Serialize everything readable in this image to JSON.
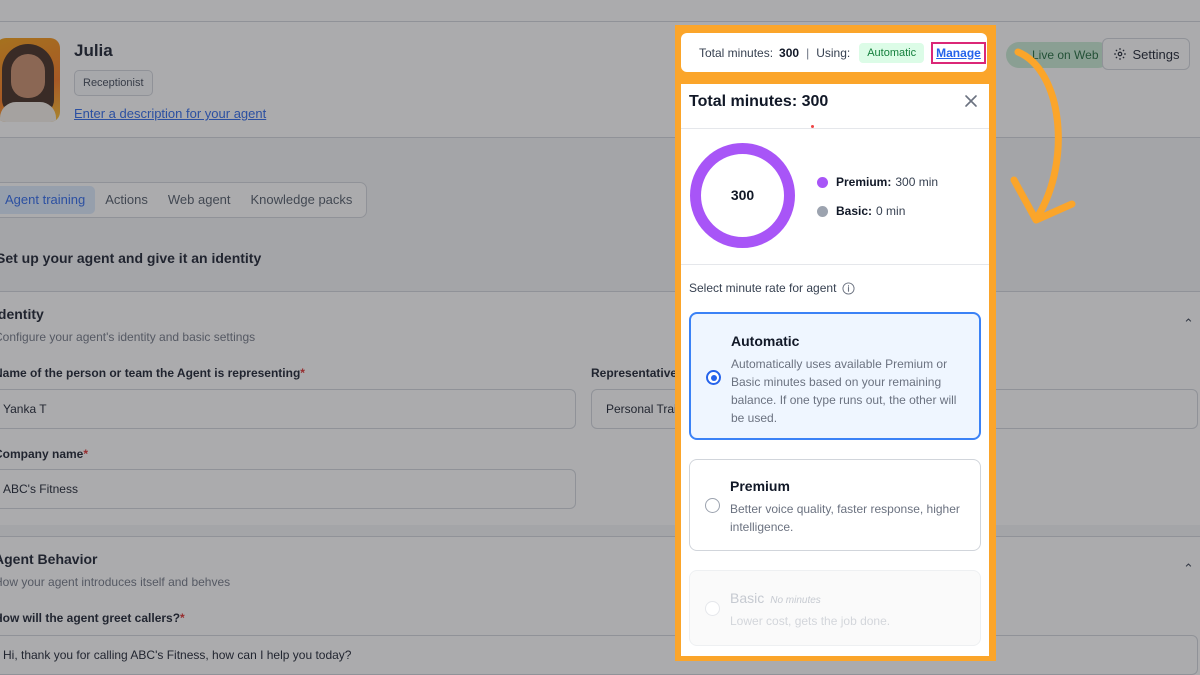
{
  "agent": {
    "name": "Julia",
    "role": "Receptionist",
    "description_link": "Enter a description for your agent"
  },
  "header": {
    "live_label": "Live on Web",
    "settings_label": "Settings"
  },
  "tabs": [
    {
      "label": "Agent training",
      "active": true
    },
    {
      "label": "Actions",
      "active": false
    },
    {
      "label": "Web agent",
      "active": false
    },
    {
      "label": "Knowledge packs",
      "active": false
    }
  ],
  "intro": "Set up your agent and give it an identity",
  "identity": {
    "title": "Identity",
    "subtitle": "Configure your agent's identity and basic settings",
    "person_label": "Name of the person or team the Agent is representing",
    "person_value": "Yanka T",
    "rep_label": "Representative",
    "rep_value": "Personal Trainer",
    "company_label": "Company name",
    "company_value": "ABC's Fitness"
  },
  "behavior": {
    "title": "Agent Behavior",
    "subtitle": "How your agent introduces itself and behves",
    "greet_label": "How will the agent greet callers?",
    "greet_value": "Hi, thank you for calling ABC's Fitness, how can I help you today?"
  },
  "topbar": {
    "total_label": "Total minutes:",
    "total_value": "300",
    "separator": "|",
    "using_label": "Using:",
    "mode": "Automatic",
    "manage": "Manage"
  },
  "panel": {
    "title": "Total minutes: 300",
    "total": "300",
    "legend": [
      {
        "name": "Premium:",
        "value": "300 min",
        "color": "#a855f7"
      },
      {
        "name": "Basic:",
        "value": "0 min",
        "color": "#9ca3af"
      }
    ],
    "rate_label": "Select minute rate for agent",
    "options": [
      {
        "title": "Automatic",
        "desc": "Automatically uses available Premium or Basic minutes based on your remaining balance. If one type runs out, the other will be used.",
        "selected": true,
        "disabled": false
      },
      {
        "title": "Premium",
        "desc": "Better voice quality, faster response, higher intelligence.",
        "selected": false,
        "disabled": false
      },
      {
        "title": "Basic",
        "note": "No minutes",
        "desc": "Lower cost, gets the job done.",
        "selected": false,
        "disabled": true
      }
    ]
  },
  "colors": {
    "highlight_frame": "#fba52a",
    "manage_box": "#db2777",
    "accent": "#2563eb",
    "premium": "#a855f7",
    "basic": "#9ca3af"
  }
}
